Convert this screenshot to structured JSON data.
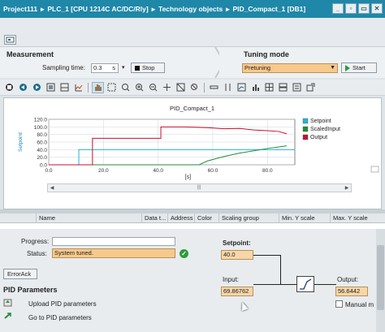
{
  "breadcrumb": [
    "Project111",
    "PLC_1 [CPU 1214C AC/DC/Rly]",
    "Technology objects",
    "PID_Compact_1 [DB1]"
  ],
  "breadcrumb_sep": "▸",
  "window_buttons": [
    "_",
    "▫",
    "▭",
    "✕"
  ],
  "measurement": {
    "title": "Measurement",
    "sampling_label": "Sampling time:",
    "sampling_value": "0.3",
    "sampling_unit": "s",
    "stop_label": "Stop"
  },
  "tuning": {
    "title": "Tuning mode",
    "mode_value": "Pretuning",
    "start_label": "Start"
  },
  "chart_data": {
    "type": "line",
    "title": "PID_Compact_1",
    "xlabel": "[s]",
    "ylabel": "Setpoint",
    "xlim": [
      0,
      90
    ],
    "ylim": [
      0,
      120
    ],
    "xticks": [
      "0.0",
      "20.0",
      "40.0",
      "60.0",
      "80.0"
    ],
    "yticks": [
      "0.0",
      "20.0",
      "40.0",
      "60.0",
      "80.0",
      "100.0",
      "120.0"
    ],
    "series": [
      {
        "name": "Setpoint",
        "color": "#21b5d9",
        "x": [
          0,
          11,
          11,
          90
        ],
        "y": [
          0,
          0,
          40,
          40
        ]
      },
      {
        "name": "ScaledInput",
        "color": "#1e8c3a",
        "x": [
          0,
          55,
          58,
          62,
          66,
          70,
          75,
          80,
          85,
          87
        ],
        "y": [
          0,
          0,
          10,
          18,
          25,
          31,
          37,
          43,
          48,
          50
        ]
      },
      {
        "name": "Output",
        "color": "#c8102e",
        "x": [
          0,
          16,
          16,
          41,
          41,
          50,
          58,
          64,
          70,
          75,
          80,
          84,
          87
        ],
        "y": [
          0,
          0,
          70,
          70,
          100,
          100,
          98,
          95,
          96,
          92,
          90,
          88,
          82
        ]
      }
    ],
    "legend": "right"
  },
  "table_headers": [
    "Name",
    "Data t...",
    "Address",
    "Color",
    "Scaling group",
    "Min. Y scale",
    "Max. Y scale"
  ],
  "status": {
    "progress_label": "Progress:",
    "status_label": "Status:",
    "status_value": "System tuned.",
    "error_ack": "ErrorAck"
  },
  "controller": {
    "setpoint_label": "Setpoint:",
    "setpoint_value": "40.0",
    "input_label": "Input:",
    "input_value": "69.86762",
    "output_label": "Output:",
    "output_value": "56.6442",
    "manual_label": "Manual m"
  },
  "pid": {
    "title": "PID Parameters",
    "upload_label": "Upload PID parameters",
    "goto_label": "Go to PID parameters"
  }
}
